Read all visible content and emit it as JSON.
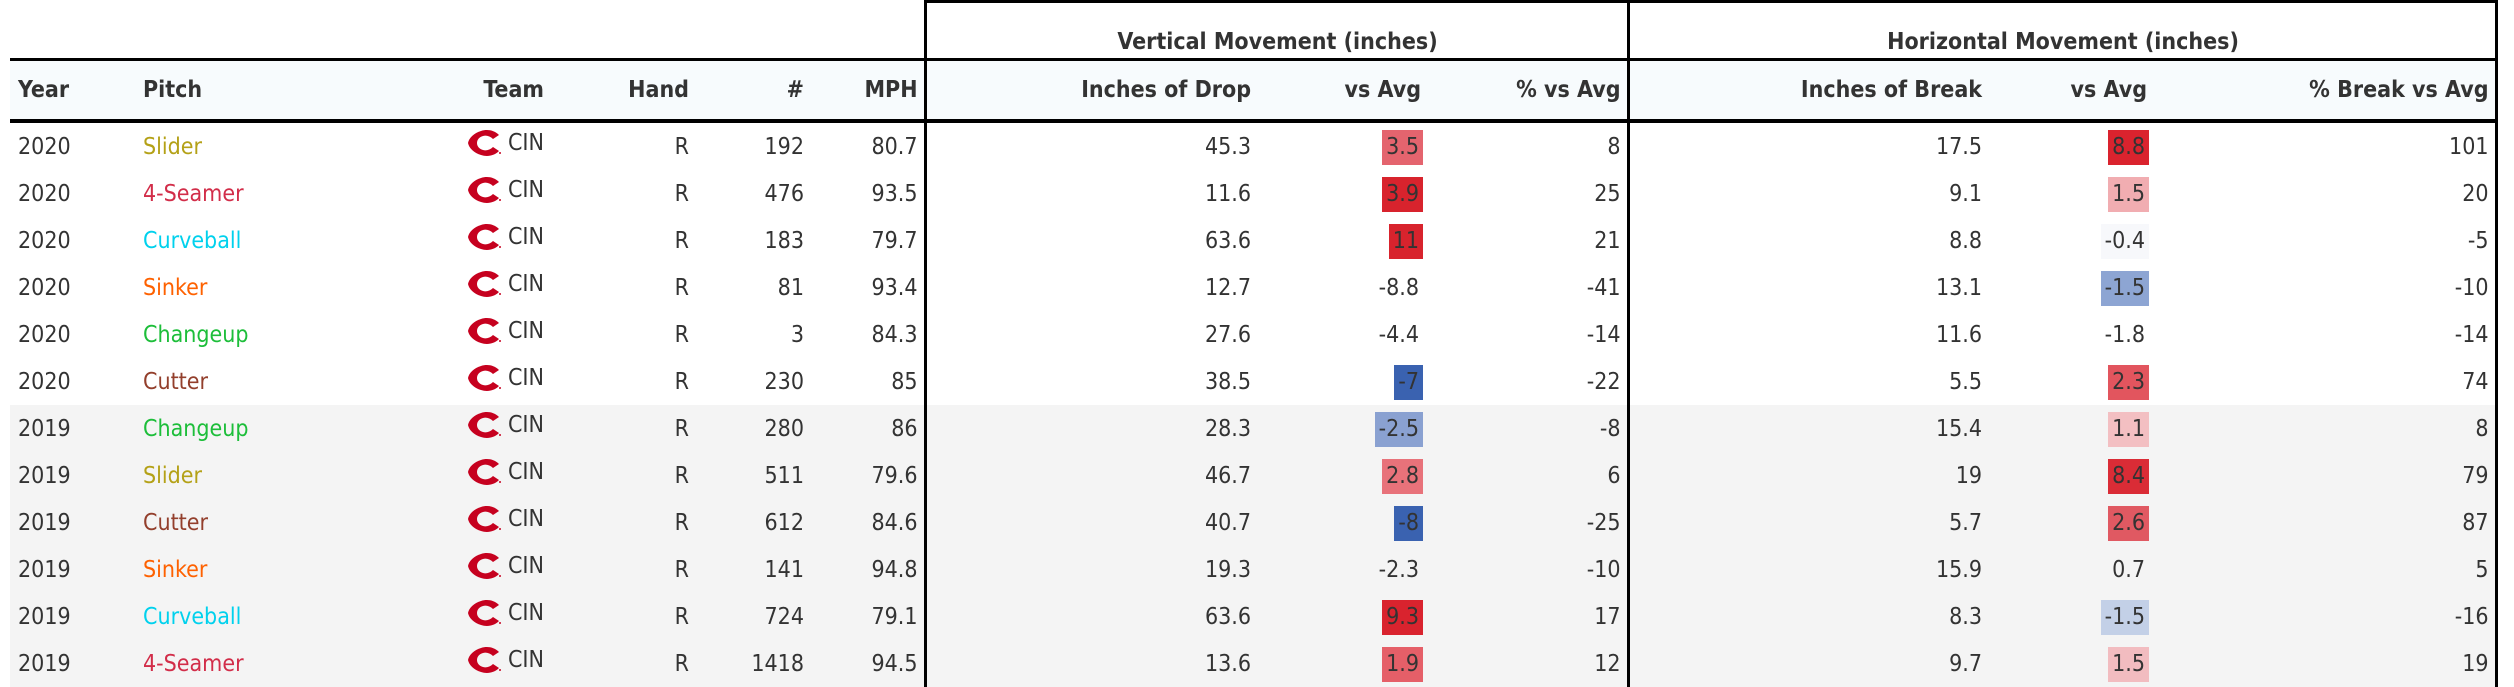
{
  "header": {
    "groups": {
      "vertical": "Vertical Movement (inches)",
      "horizontal": "Horizontal Movement (inches)"
    },
    "columns": {
      "year": "Year",
      "pitch": "Pitch",
      "team": "Team",
      "hand": "Hand",
      "count": "#",
      "mph": "MPH",
      "drop": "Inches of Drop",
      "v_vs_avg": "vs Avg",
      "v_pct_vs_avg": "% vs Avg",
      "break": "Inches of Break",
      "h_vs_avg": "vs Avg",
      "h_pct_vs_avg": "% Break vs Avg"
    }
  },
  "pitch_colors": {
    "Slider": "#b4a117",
    "4-Seamer": "#d22d49",
    "Curveball": "#00d1ed",
    "Sinker": "#fe6100",
    "Changeup": "#1dbe3a",
    "Cutter": "#933f2c"
  },
  "team_logo_color": "#c6011f",
  "rows": [
    {
      "year": "2020",
      "pitch": "Slider",
      "team": "CIN",
      "hand": "R",
      "count": "192",
      "mph": "80.7",
      "drop": "45.3",
      "v_vs_avg": "3.5",
      "v_bg": "#e4646e",
      "v_pct": "8",
      "brk": "17.5",
      "h_vs_avg": "8.8",
      "h_bg": "#da232e",
      "h_pct": "101"
    },
    {
      "year": "2020",
      "pitch": "4-Seamer",
      "team": "CIN",
      "hand": "R",
      "count": "476",
      "mph": "93.5",
      "drop": "11.6",
      "v_vs_avg": "3.9",
      "v_bg": "#d8232d",
      "v_pct": "25",
      "brk": "9.1",
      "h_vs_avg": "1.5",
      "h_bg": "#f1adb1",
      "h_pct": "20"
    },
    {
      "year": "2020",
      "pitch": "Curveball",
      "team": "CIN",
      "hand": "R",
      "count": "183",
      "mph": "79.7",
      "drop": "63.6",
      "v_vs_avg": "11",
      "v_bg": "#d8232d",
      "v_pct": "21",
      "brk": "8.8",
      "h_vs_avg": "-0.4",
      "h_bg": "#f7f8fb",
      "h_pct": "-5"
    },
    {
      "year": "2020",
      "pitch": "Sinker",
      "team": "CIN",
      "hand": "R",
      "count": "81",
      "mph": "93.4",
      "drop": "12.7",
      "v_vs_avg": "-8.8",
      "v_bg": "",
      "v_pct": "-41",
      "brk": "13.1",
      "h_vs_avg": "-1.5",
      "h_bg": "#8da5d3",
      "h_pct": "-10"
    },
    {
      "year": "2020",
      "pitch": "Changeup",
      "team": "CIN",
      "hand": "R",
      "count": "3",
      "mph": "84.3",
      "drop": "27.6",
      "v_vs_avg": "-4.4",
      "v_bg": "",
      "v_pct": "-14",
      "brk": "11.6",
      "h_vs_avg": "-1.8",
      "h_bg": "",
      "h_pct": "-14"
    },
    {
      "year": "2020",
      "pitch": "Cutter",
      "team": "CIN",
      "hand": "R",
      "count": "230",
      "mph": "85",
      "drop": "38.5",
      "v_vs_avg": "-7",
      "v_bg": "#3a62b0",
      "v_pct": "-22",
      "brk": "5.5",
      "h_vs_avg": "2.3",
      "h_bg": "#e2555e",
      "h_pct": "74"
    },
    {
      "year": "2019",
      "pitch": "Changeup",
      "team": "CIN",
      "hand": "R",
      "count": "280",
      "mph": "86",
      "drop": "28.3",
      "v_vs_avg": "-2.5",
      "v_bg": "#8aa1d1",
      "v_pct": "-8",
      "brk": "15.4",
      "h_vs_avg": "1.1",
      "h_bg": "#f3bfc2",
      "h_pct": "8"
    },
    {
      "year": "2019",
      "pitch": "Slider",
      "team": "CIN",
      "hand": "R",
      "count": "511",
      "mph": "79.6",
      "drop": "46.7",
      "v_vs_avg": "2.8",
      "v_bg": "#e8727a",
      "v_pct": "6",
      "brk": "19",
      "h_vs_avg": "8.4",
      "h_bg": "#da2c36",
      "h_pct": "79"
    },
    {
      "year": "2019",
      "pitch": "Cutter",
      "team": "CIN",
      "hand": "R",
      "count": "612",
      "mph": "84.6",
      "drop": "40.7",
      "v_vs_avg": "-8",
      "v_bg": "#3a62b0",
      "v_pct": "-25",
      "brk": "5.7",
      "h_vs_avg": "2.6",
      "h_bg": "#e05962",
      "h_pct": "87"
    },
    {
      "year": "2019",
      "pitch": "Sinker",
      "team": "CIN",
      "hand": "R",
      "count": "141",
      "mph": "94.8",
      "drop": "19.3",
      "v_vs_avg": "-2.3",
      "v_bg": "",
      "v_pct": "-10",
      "brk": "15.9",
      "h_vs_avg": "0.7",
      "h_bg": "",
      "h_pct": "5"
    },
    {
      "year": "2019",
      "pitch": "Curveball",
      "team": "CIN",
      "hand": "R",
      "count": "724",
      "mph": "79.1",
      "drop": "63.6",
      "v_vs_avg": "9.3",
      "v_bg": "#d9232e",
      "v_pct": "17",
      "brk": "8.3",
      "h_vs_avg": "-1.5",
      "h_bg": "#c3d0e7",
      "h_pct": "-16"
    },
    {
      "year": "2019",
      "pitch": "4-Seamer",
      "team": "CIN",
      "hand": "R",
      "count": "1418",
      "mph": "94.5",
      "drop": "13.6",
      "v_vs_avg": "1.9",
      "v_bg": "#e55f68",
      "v_pct": "12",
      "brk": "9.7",
      "h_vs_avg": "1.5",
      "h_bg": "#f2bcc0",
      "h_pct": "19"
    }
  ]
}
